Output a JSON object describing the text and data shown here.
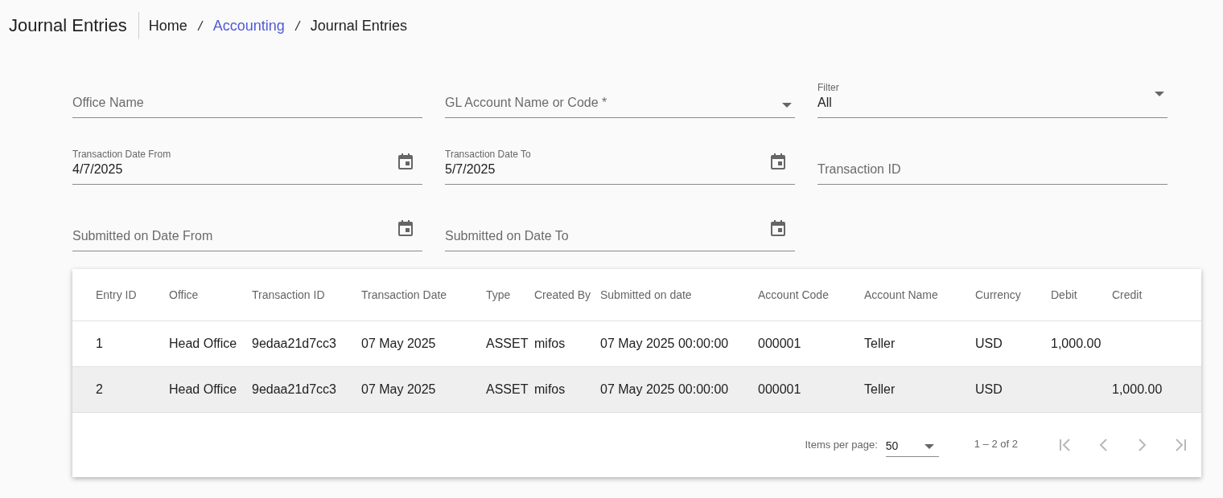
{
  "header": {
    "title": "Journal Entries",
    "breadcrumbs": [
      {
        "label": "Home",
        "link": false
      },
      {
        "label": "Accounting",
        "link": true
      },
      {
        "label": "Journal Entries",
        "link": false
      }
    ]
  },
  "filters": [
    {
      "kind": "text",
      "placeholder": "Office Name"
    },
    {
      "kind": "select",
      "placeholder": "GL Account Name or Code *"
    },
    {
      "kind": "select",
      "label": "Filter",
      "value": "All"
    },
    {
      "kind": "date",
      "label": "Transaction Date From",
      "value": "4/7/2025"
    },
    {
      "kind": "date",
      "label": "Transaction Date To",
      "value": "5/7/2025"
    },
    {
      "kind": "text",
      "placeholder": "Transaction ID"
    },
    {
      "kind": "date",
      "placeholder": "Submitted on Date From"
    },
    {
      "kind": "date",
      "placeholder": "Submitted on Date To"
    }
  ],
  "table": {
    "columns": [
      "Entry ID",
      "Office",
      "Transaction ID",
      "Transaction Date",
      "Type",
      "Created By",
      "Submitted on date",
      "Account Code",
      "Account Name",
      "Currency",
      "Debit",
      "Credit"
    ],
    "rows": [
      {
        "selected": false,
        "cells": [
          "1",
          "Head Office",
          "9edaa21d7cc3",
          "07 May 2025",
          "ASSET",
          "mifos",
          "07 May 2025 00:00:00",
          "000001",
          "Teller",
          "USD",
          "1,000.00",
          ""
        ]
      },
      {
        "selected": true,
        "cells": [
          "2",
          "Head Office",
          "9edaa21d7cc3",
          "07 May 2025",
          "ASSET",
          "mifos",
          "07 May 2025 00:00:00",
          "000001",
          "Teller",
          "USD",
          "",
          "1,000.00"
        ]
      }
    ]
  },
  "paginator": {
    "items_per_page_label": "Items per page:",
    "page_size": "50",
    "range": "1 – 2 of 2",
    "buttons": [
      {
        "kind": "first",
        "disabled": true
      },
      {
        "kind": "previous",
        "disabled": true
      },
      {
        "kind": "next",
        "disabled": true
      },
      {
        "kind": "last",
        "disabled": true
      }
    ]
  }
}
